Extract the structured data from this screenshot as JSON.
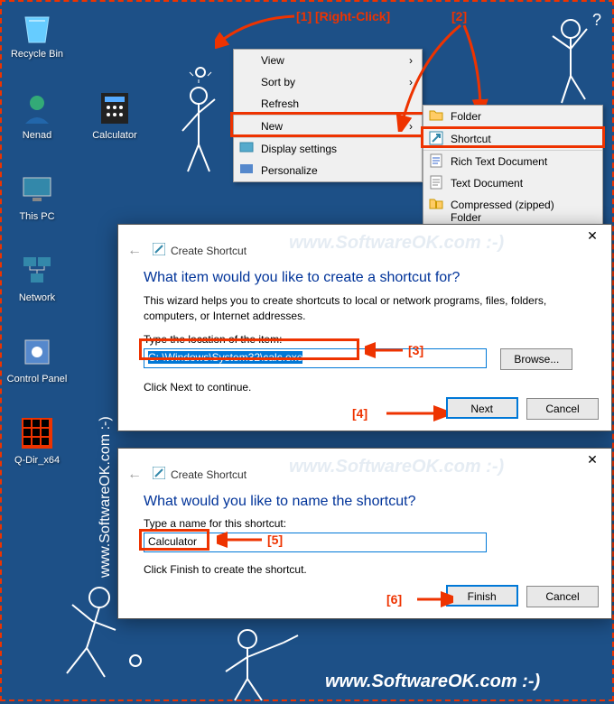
{
  "desktop": {
    "icons": [
      {
        "label": "Recycle Bin"
      },
      {
        "label": "Nenad"
      },
      {
        "label": "Calculator"
      },
      {
        "label": "This PC"
      },
      {
        "label": "Network"
      },
      {
        "label": "Control Panel"
      },
      {
        "label": "Q-Dir_x64"
      }
    ]
  },
  "context1": {
    "items": [
      {
        "label": "View",
        "arrow": true
      },
      {
        "label": "Sort by",
        "arrow": true
      },
      {
        "label": "Refresh"
      },
      {
        "label": "New",
        "arrow": true
      },
      {
        "label": "Display settings"
      },
      {
        "label": "Personalize"
      }
    ]
  },
  "context2": {
    "items": [
      {
        "label": "Folder"
      },
      {
        "label": "Shortcut"
      },
      {
        "label": "Rich Text Document"
      },
      {
        "label": "Text Document"
      },
      {
        "label": "Compressed (zipped) Folder"
      }
    ]
  },
  "dialog1": {
    "title": "Create Shortcut",
    "heading": "What item would you like to create a shortcut for?",
    "desc": "This wizard helps you to create shortcuts to local or network programs, files, folders, computers, or Internet addresses.",
    "field_label": "Type the location of the item:",
    "field_value": "C: \\Windows\\System32\\calc.exe",
    "browse": "Browse...",
    "hint": "Click Next to continue.",
    "next": "Next",
    "cancel": "Cancel"
  },
  "dialog2": {
    "title": "Create Shortcut",
    "heading": "What would you like to name the shortcut?",
    "field_label": "Type a name for this shortcut:",
    "field_value": "Calculator",
    "hint": "Click Finish to create the shortcut.",
    "finish": "Finish",
    "cancel": "Cancel"
  },
  "annotations": {
    "a1": "[1]  [Right-Click]",
    "a2": "[2]",
    "a3": "[3]",
    "a4": "[4]",
    "a5": "[5]",
    "a6": "[6]"
  },
  "watermark": "www.SoftwareOK.com  :-)"
}
